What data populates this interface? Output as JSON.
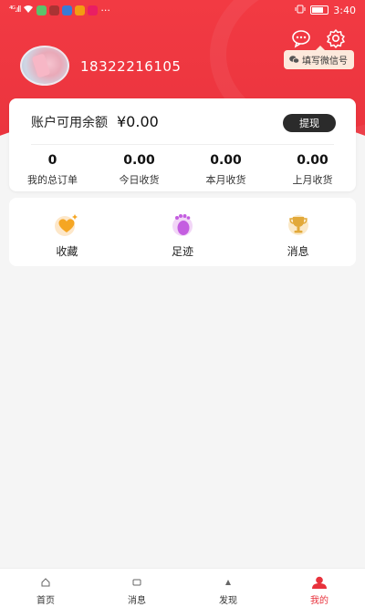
{
  "status_bar": {
    "signal": "⁴ᴳ.ıll",
    "time": "3:40",
    "dots": "···"
  },
  "tip": {
    "text": "填写微信号"
  },
  "user": {
    "phone": "18322216105"
  },
  "account": {
    "balance_label": "账户可用余额",
    "balance_value": "¥0.00",
    "withdraw_label": "提现",
    "stats": [
      {
        "value": "0",
        "label": "我的总订单"
      },
      {
        "value": "0.00",
        "label": "今日收货"
      },
      {
        "value": "0.00",
        "label": "本月收货"
      },
      {
        "value": "0.00",
        "label": "上月收货"
      }
    ]
  },
  "shortcuts": [
    {
      "label": "收藏",
      "icon": "heart-icon"
    },
    {
      "label": "足迹",
      "icon": "footprint-icon"
    },
    {
      "label": "消息",
      "icon": "trophy-icon"
    }
  ],
  "nav": [
    {
      "label": "首页",
      "icon": "home-icon",
      "active": false
    },
    {
      "label": "消息",
      "icon": "message-icon",
      "active": false
    },
    {
      "label": "发现",
      "icon": "discover-icon",
      "active": false
    },
    {
      "label": "我的",
      "icon": "user-icon",
      "active": true
    }
  ],
  "colors": {
    "brand_red": "#e8323c",
    "heart_orange": "#f5a623",
    "foot_purple": "#c45ee0",
    "trophy_gold": "#e2a93a"
  }
}
